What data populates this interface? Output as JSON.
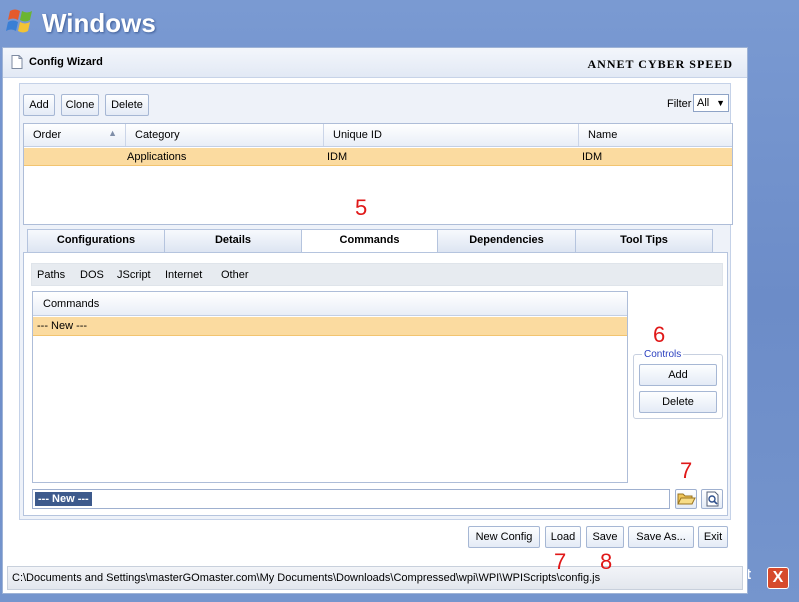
{
  "desktop": {
    "os_title": "Windows",
    "exit_tail": "it",
    "exit_glyph": "X"
  },
  "window": {
    "title": "Config Wizard",
    "brand": "ANNET CYBER SPEED"
  },
  "toolbar": {
    "add_label": "Add",
    "clone_label": "Clone",
    "delete_label": "Delete",
    "filter_label": "Filter",
    "filter_value": "All"
  },
  "config_grid": {
    "columns": [
      "Order",
      "Category",
      "Unique ID",
      "Name"
    ],
    "rows": [
      {
        "order": "",
        "category": "Applications",
        "unique_id": "IDM",
        "name": "IDM"
      }
    ]
  },
  "tabs": [
    {
      "label": "Configurations"
    },
    {
      "label": "Details"
    },
    {
      "label": "Commands",
      "active": true
    },
    {
      "label": "Dependencies"
    },
    {
      "label": "Tool Tips"
    }
  ],
  "subtabs": [
    "Paths",
    "DOS",
    "JScript",
    "Internet",
    "Other"
  ],
  "commands": {
    "header": "Commands",
    "items": [
      "--- New ---"
    ],
    "input_value": "--- New ---"
  },
  "controls": {
    "legend": "Controls",
    "add_label": "Add",
    "delete_label": "Delete"
  },
  "icons": {
    "folder": "folder-open-icon",
    "inspect": "search-document-icon"
  },
  "footer": {
    "new_config": "New Config",
    "load": "Load",
    "save": "Save",
    "save_as": "Save As...",
    "exit": "Exit"
  },
  "status": {
    "path": "C:\\Documents and Settings\\masterGOmaster.com\\My Documents\\Downloads\\Compressed\\wpi\\WPI\\WPIScripts\\config.js"
  },
  "annotations": {
    "tabs_marker": "5",
    "controls_marker": "6",
    "browse_marker": "7",
    "load_marker": "7",
    "save_marker": "8"
  },
  "colors": {
    "selection_row": "#fbdba0",
    "accent_blue": "#6f8fc9",
    "annotation_red": "#e01818"
  }
}
